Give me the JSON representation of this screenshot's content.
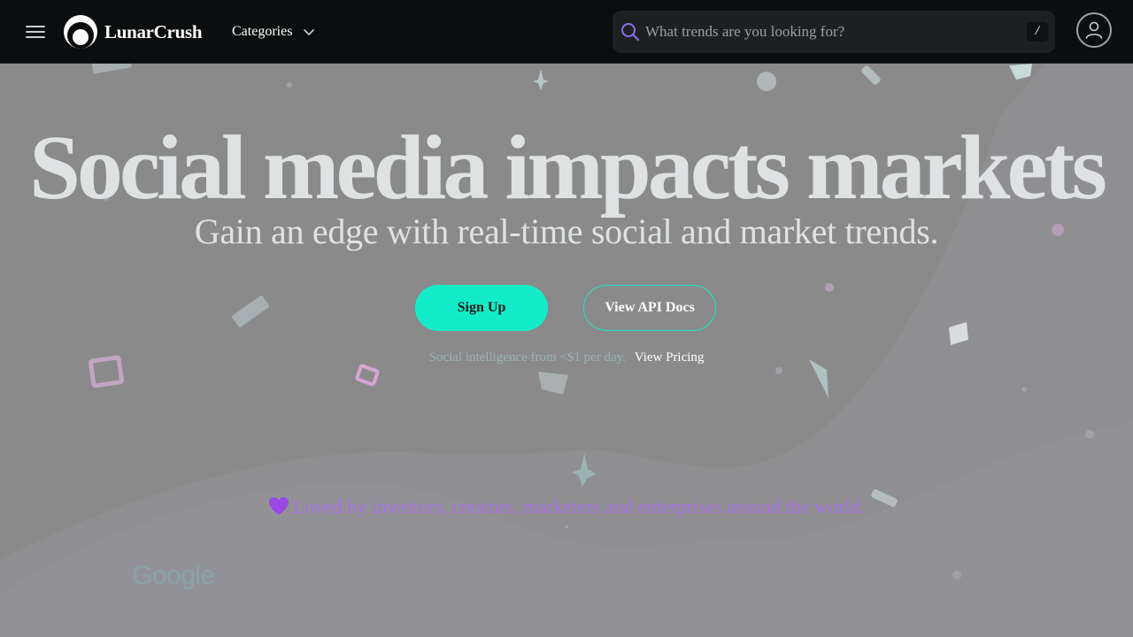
{
  "header": {
    "menu_icon": "hamburger-icon",
    "brand": "LunarCrush",
    "brand_icon": "lunarcrush-moon-logo",
    "categories_label": "Categories",
    "search_placeholder": "What trends are you looking for?",
    "search_shortcut": "/",
    "account_icon": "user-icon"
  },
  "hero": {
    "title": "Social media impacts markets",
    "subtitle": "Gain an edge with real-time social and market trends.",
    "signup_label": "Sign Up",
    "api_docs_label": "View API Docs",
    "pricing_note": "Social intelligence from <$1 per day.",
    "pricing_link": "View Pricing",
    "loved_text": "Loved by investors, creators, marketers and enterprises around the world.",
    "loved_icon": "purple-heart-icon"
  },
  "logos": {
    "google": "Google"
  },
  "colors": {
    "accent": "#14ecc9",
    "header_bg": "#0b0d0e",
    "page_bg": "#8a8a8a",
    "loved_text": "#a970e8"
  }
}
